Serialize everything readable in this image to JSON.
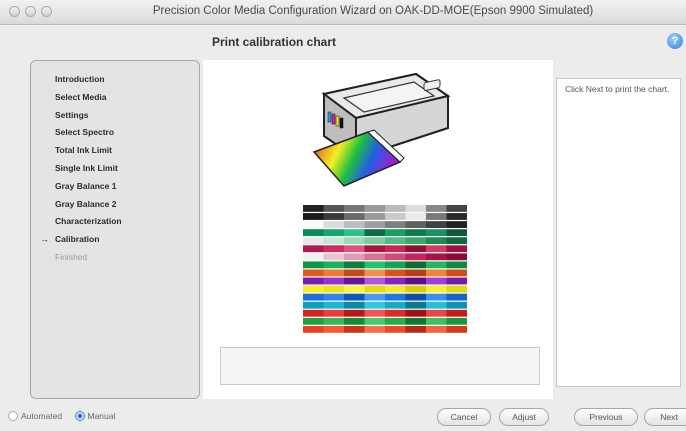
{
  "window": {
    "title": "Precision Color Media Configuration Wizard on OAK-DD-MOE(Epson 9900 Simulated)"
  },
  "header": {
    "step_title": "Print calibration chart",
    "help_icon": "?"
  },
  "steps": [
    {
      "label": "Introduction",
      "state": "done"
    },
    {
      "label": "Select Media",
      "state": "done"
    },
    {
      "label": "Settings",
      "state": "done"
    },
    {
      "label": "Select Spectro",
      "state": "done"
    },
    {
      "label": "Total Ink Limit",
      "state": "done"
    },
    {
      "label": "Single Ink Limit",
      "state": "done"
    },
    {
      "label": "Gray Balance 1",
      "state": "done"
    },
    {
      "label": "Gray Balance 2",
      "state": "done"
    },
    {
      "label": "Characterization",
      "state": "done"
    },
    {
      "label": "Calibration",
      "state": "current"
    },
    {
      "label": "Finished",
      "state": "disabled"
    }
  ],
  "current_step_icon": "arrow-right-icon",
  "info": {
    "text": "Click Next to print the chart."
  },
  "footer": {
    "mode_options": [
      "Automated",
      "Manual"
    ],
    "selected_mode": "Manual",
    "buttons": {
      "cancel": "Cancel",
      "adjust": "Adjust",
      "previous": "Previous",
      "next": "Next"
    }
  },
  "chart_strip": {
    "rows": [
      [
        "#222",
        "#555",
        "#777",
        "#999",
        "#bbb",
        "#ddd",
        "#888",
        "#444"
      ],
      [
        "#1a1a1a",
        "#3a3a3a",
        "#6a6a6a",
        "#9a9a9a",
        "#cacaca",
        "#eaeaea",
        "#7a7a7a",
        "#2a2a2a"
      ],
      [
        "#fbfbfb",
        "#dcdcdc",
        "#bdbdbd",
        "#9e9e9e",
        "#7f7f7f",
        "#606060",
        "#414141",
        "#222222"
      ],
      [
        "#0b8a5a",
        "#12a86f",
        "#2bc488",
        "#0e6b44",
        "#17a060",
        "#0f7a4e",
        "#1b9168",
        "#0c5a3a"
      ],
      [
        "#e8e8e8",
        "#c4e8d4",
        "#9ed9b9",
        "#7bcca0",
        "#52be84",
        "#35a86a",
        "#1f8a52",
        "#0b6b3c"
      ],
      [
        "#b01b4a",
        "#d02b5e",
        "#e2507c",
        "#a8153e",
        "#c92456",
        "#8e1034",
        "#d23a68",
        "#9a1340"
      ],
      [
        "#f2f2f2",
        "#e9c4d2",
        "#df9cb4",
        "#d67496",
        "#cc4d79",
        "#c1265b",
        "#a81347",
        "#8a0a36"
      ],
      [
        "#0a9848",
        "#17b35a",
        "#0d7e3c",
        "#1fc46b",
        "#13a352",
        "#0b6f34",
        "#22b863",
        "#0f8a44"
      ],
      [
        "#e05a1c",
        "#f07a32",
        "#c9481a",
        "#f29046",
        "#d8521c",
        "#b83f14",
        "#ef8436",
        "#cf4c18"
      ],
      [
        "#7a1ab0",
        "#9b2fd0",
        "#6a1298",
        "#b054e0",
        "#8a22c0",
        "#5e0f88",
        "#a43cd6",
        "#741aa6"
      ],
      [
        "#f5f020",
        "#ede418",
        "#f7f440",
        "#e8dc10",
        "#f2ea2a",
        "#dcd00c",
        "#f6f232",
        "#e4d814"
      ],
      [
        "#1a6fd8",
        "#2f85ea",
        "#1258b8",
        "#4a9af2",
        "#1e78e0",
        "#0f4ea4",
        "#3a8eee",
        "#1664c8"
      ],
      [
        "#0aa0b8",
        "#18b8d0",
        "#088aa0",
        "#30c8dc",
        "#12acc4",
        "#067a8e",
        "#24c0d6",
        "#0c96ae"
      ],
      [
        "#d82020",
        "#ee3a3a",
        "#b81818",
        "#f25454",
        "#e02a2a",
        "#a01212",
        "#ea4646",
        "#c81c1c"
      ],
      [
        "#20a040",
        "#34b858",
        "#188a34",
        "#48c86c",
        "#28ac4a",
        "#10782a",
        "#3cc060",
        "#1c963c"
      ],
      [
        "#e84020",
        "#f25a34",
        "#c83418",
        "#f47048",
        "#ec4a28",
        "#b02c12",
        "#f06440",
        "#d43a1c"
      ]
    ]
  }
}
